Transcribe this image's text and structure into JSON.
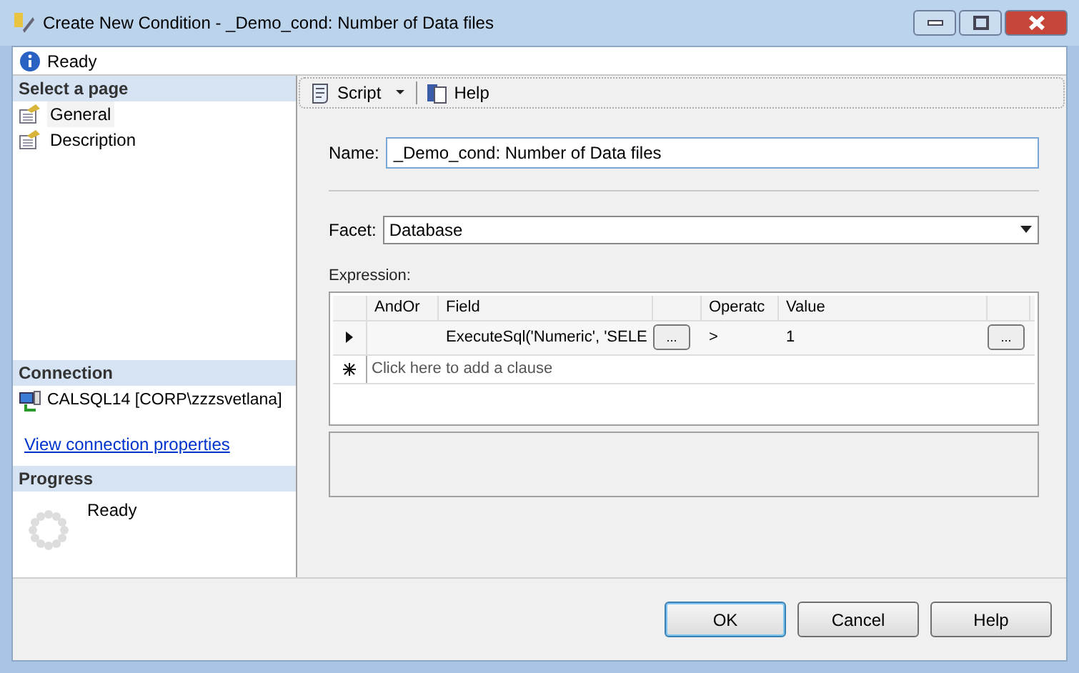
{
  "window": {
    "title": "Create New Condition - _Demo_cond: Number of Data files"
  },
  "status": {
    "text": "Ready"
  },
  "sidebar": {
    "header": "Select a page",
    "items": [
      {
        "label": "General",
        "selected": true
      },
      {
        "label": "Description",
        "selected": false
      }
    ]
  },
  "connection": {
    "header": "Connection",
    "server": "CALSQL14 [CORP\\zzzsvetlana]",
    "link": "View connection properties"
  },
  "progress": {
    "header": "Progress",
    "text": "Ready"
  },
  "toolbar": {
    "script": "Script",
    "help": "Help"
  },
  "name": {
    "label": "Name:",
    "value": "_Demo_cond: Number of Data files"
  },
  "facet": {
    "label": "Facet:",
    "value": "Database"
  },
  "expression": {
    "label": "Expression:",
    "columns": [
      "AndOr",
      "Field",
      "Operatc",
      "Value"
    ],
    "rows": [
      {
        "andor": "",
        "field": "ExecuteSql('Numeric', 'SELE",
        "field_button": "...",
        "operator": ">",
        "value": "1",
        "value_button": "..."
      }
    ],
    "new_row": "Click here to add a clause"
  },
  "buttons": [
    "OK",
    "Cancel",
    "Help"
  ]
}
